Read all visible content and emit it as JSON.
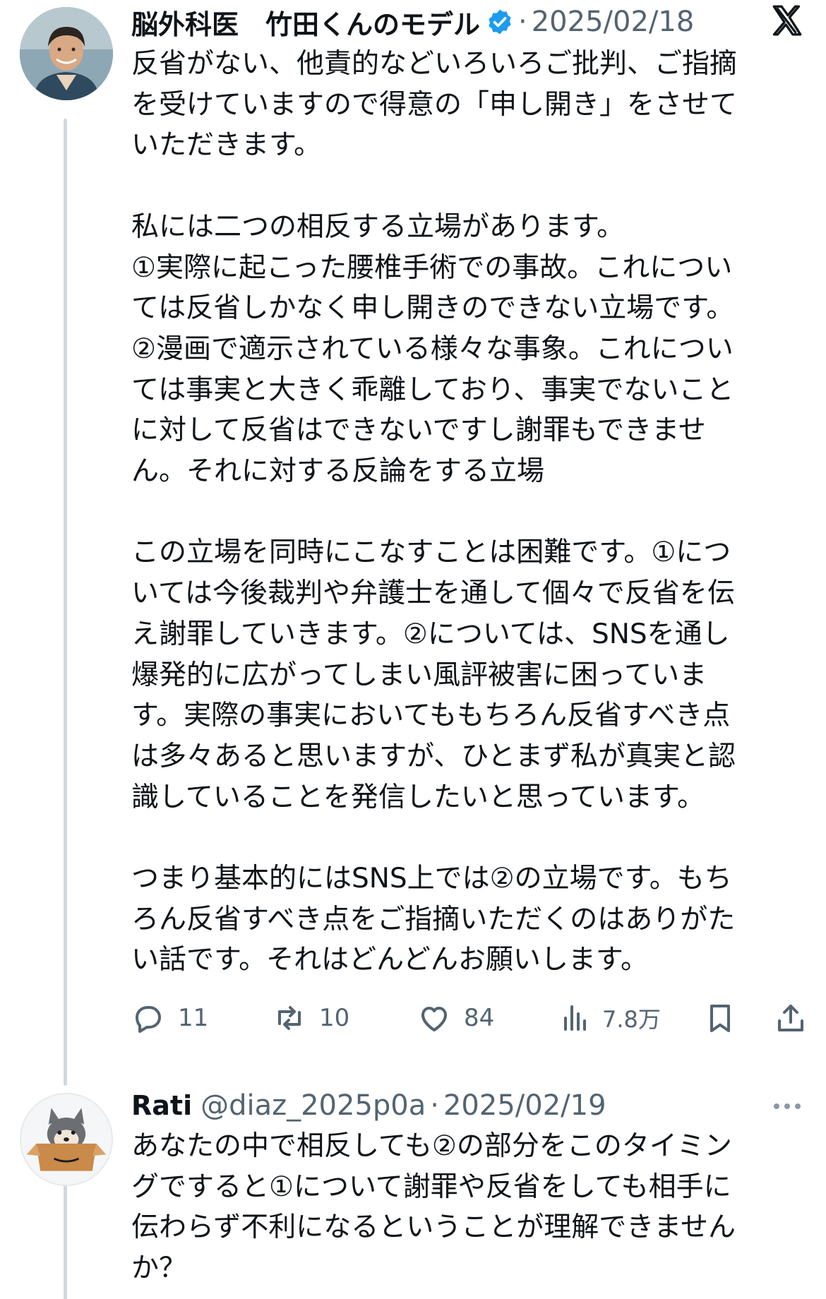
{
  "tweet": {
    "author_name": "脳外科医　竹田くんのモデル",
    "verified": true,
    "date": "2025/02/18",
    "paragraphs": [
      "反省がない、他責的などいろいろご批判、ご指摘\nを受けていますので得意の「申し開き」をさせて\nいただきます。",
      "私には二つの相反する立場があります。\n①実際に起こった腰椎手術での事故。これについ\nては反省しかなく申し開きのできない立場です。\n②漫画で適示されている様々な事象。これについ\nては事実と大きく乖離しており、事実でないこと\nに対して反省はできないですし謝罪もできませ\nん。それに対する反論をする立場",
      "この立場を同時にこなすことは困難です。①につ\nいては今後裁判や弁護士を通して個々で反省を伝\nえ謝罪していきます。②については、SNSを通し\n爆発的に広がってしまい風評被害に困っていま\nす。実際の事実においてももちろん反省すべき点\nは多々あると思いますが、ひとまず私が真実と認\n識していることを発信したいと思っています。",
      "つまり基本的にはSNS上では②の立場です。もち\nろん反省すべき点をご指摘いただくのはありがた\nい話です。それはどんどんお願いします。"
    ],
    "actions": {
      "reply_count": "11",
      "retweet_count": "10",
      "like_count": "84",
      "views_count": "7.8万"
    }
  },
  "reply": {
    "author_name": "Rati",
    "handle": "@diaz_2025p0a",
    "date": "2025/02/19",
    "text": "あなたの中で相反しても②の部分をこのタイミン\nグですると①について謝罪や反省をしても相手に\n伝わらず不利になるということが理解できません\nか？"
  },
  "ui": {
    "separator_dot": "·",
    "icons": [
      "x-logo-icon",
      "verified-badge-icon",
      "reply-icon",
      "retweet-icon",
      "like-icon",
      "views-icon",
      "bookmark-icon",
      "share-icon",
      "more-icon"
    ],
    "colors": {
      "text": "#0f1419",
      "secondary": "#536471",
      "verified": "#1d9bf0",
      "thread_line": "#cfd9de"
    }
  }
}
